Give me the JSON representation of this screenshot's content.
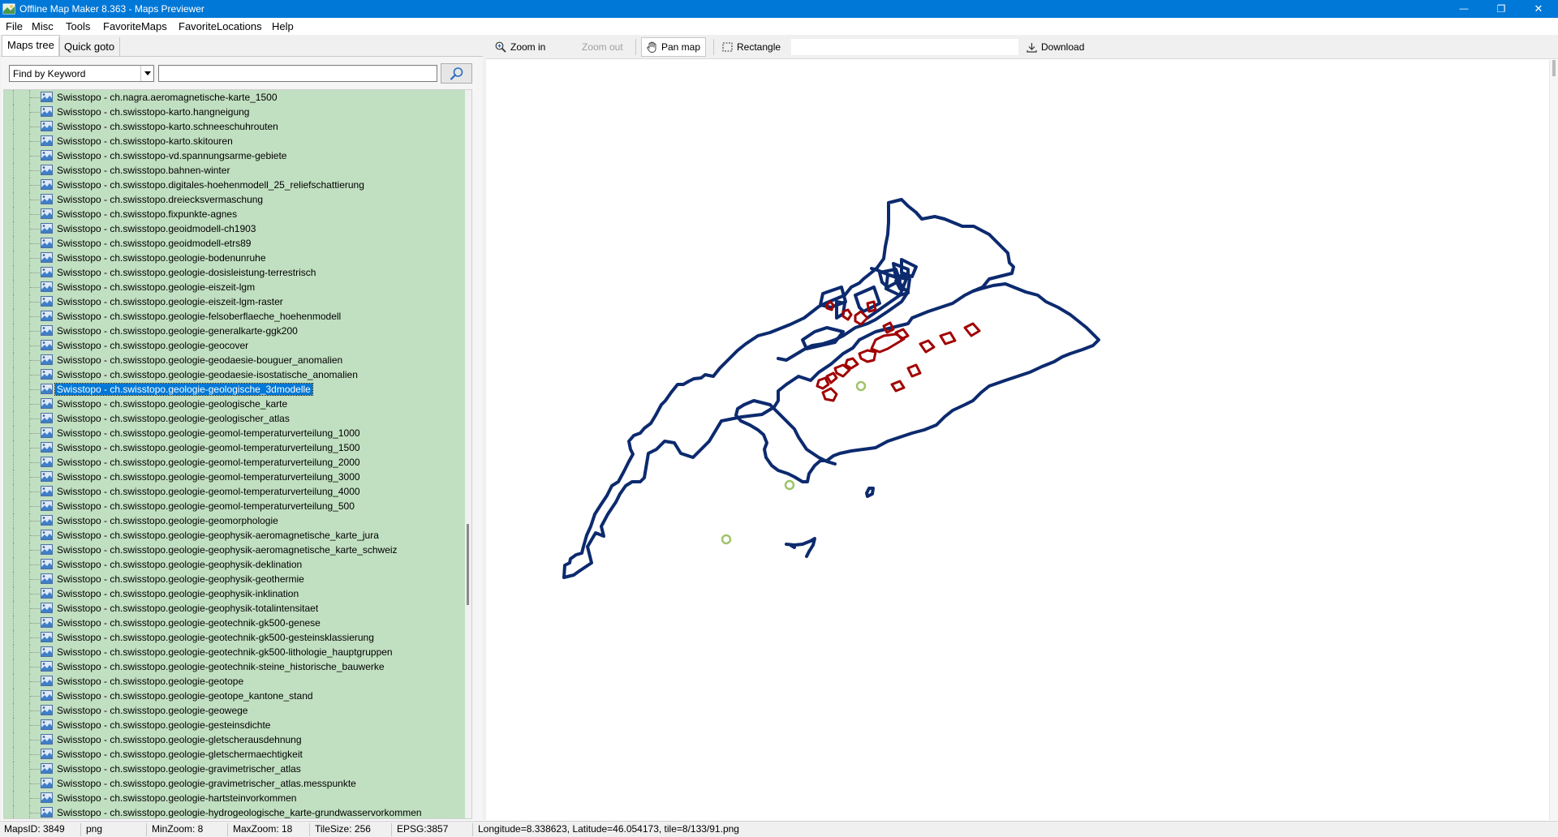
{
  "window": {
    "title": "Offline Map Maker 8.363 - Maps Previewer",
    "minimize_glyph": "—",
    "maximize_glyph": "❐",
    "close_glyph": "✕"
  },
  "menu": {
    "items": [
      "File",
      "Misc",
      "Tools",
      "FavoriteMaps",
      "FavoriteLocations",
      "Help"
    ]
  },
  "tabs": {
    "maps_tree": "Maps tree",
    "quick_goto": "Quick goto"
  },
  "search": {
    "mode": "Find by Keyword",
    "value": ""
  },
  "tree": {
    "selected_index": 20,
    "items": [
      "Swisstopo - ch.nagra.aeromagnetische-karte_1500",
      "Swisstopo - ch.swisstopo-karto.hangneigung",
      "Swisstopo - ch.swisstopo-karto.schneeschuhrouten",
      "Swisstopo - ch.swisstopo-karto.skitouren",
      "Swisstopo - ch.swisstopo-vd.spannungsarme-gebiete",
      "Swisstopo - ch.swisstopo.bahnen-winter",
      "Swisstopo - ch.swisstopo.digitales-hoehenmodell_25_reliefschattierung",
      "Swisstopo - ch.swisstopo.dreiecksvermaschung",
      "Swisstopo - ch.swisstopo.fixpunkte-agnes",
      "Swisstopo - ch.swisstopo.geoidmodell-ch1903",
      "Swisstopo - ch.swisstopo.geoidmodell-etrs89",
      "Swisstopo - ch.swisstopo.geologie-bodenunruhe",
      "Swisstopo - ch.swisstopo.geologie-dosisleistung-terrestrisch",
      "Swisstopo - ch.swisstopo.geologie-eiszeit-lgm",
      "Swisstopo - ch.swisstopo.geologie-eiszeit-lgm-raster",
      "Swisstopo - ch.swisstopo.geologie-felsoberflaeche_hoehenmodell",
      "Swisstopo - ch.swisstopo.geologie-generalkarte-ggk200",
      "Swisstopo - ch.swisstopo.geologie-geocover",
      "Swisstopo - ch.swisstopo.geologie-geodaesie-bouguer_anomalien",
      "Swisstopo - ch.swisstopo.geologie-geodaesie-isostatische_anomalien",
      "Swisstopo - ch.swisstopo.geologie-geologische_3dmodelle",
      "Swisstopo - ch.swisstopo.geologie-geologische_karte",
      "Swisstopo - ch.swisstopo.geologie-geologischer_atlas",
      "Swisstopo - ch.swisstopo.geologie-geomol-temperaturverteilung_1000",
      "Swisstopo - ch.swisstopo.geologie-geomol-temperaturverteilung_1500",
      "Swisstopo - ch.swisstopo.geologie-geomol-temperaturverteilung_2000",
      "Swisstopo - ch.swisstopo.geologie-geomol-temperaturverteilung_3000",
      "Swisstopo - ch.swisstopo.geologie-geomol-temperaturverteilung_4000",
      "Swisstopo - ch.swisstopo.geologie-geomol-temperaturverteilung_500",
      "Swisstopo - ch.swisstopo.geologie-geomorphologie",
      "Swisstopo - ch.swisstopo.geologie-geophysik-aeromagnetische_karte_jura",
      "Swisstopo - ch.swisstopo.geologie-geophysik-aeromagnetische_karte_schweiz",
      "Swisstopo - ch.swisstopo.geologie-geophysik-deklination",
      "Swisstopo - ch.swisstopo.geologie-geophysik-geothermie",
      "Swisstopo - ch.swisstopo.geologie-geophysik-inklination",
      "Swisstopo - ch.swisstopo.geologie-geophysik-totalintensitaet",
      "Swisstopo - ch.swisstopo.geologie-geotechnik-gk500-genese",
      "Swisstopo - ch.swisstopo.geologie-geotechnik-gk500-gesteinsklassierung",
      "Swisstopo - ch.swisstopo.geologie-geotechnik-gk500-lithologie_hauptgruppen",
      "Swisstopo - ch.swisstopo.geologie-geotechnik-steine_historische_bauwerke",
      "Swisstopo - ch.swisstopo.geologie-geotope",
      "Swisstopo - ch.swisstopo.geologie-geotope_kantone_stand",
      "Swisstopo - ch.swisstopo.geologie-geowege",
      "Swisstopo - ch.swisstopo.geologie-gesteinsdichte",
      "Swisstopo - ch.swisstopo.geologie-gletscherausdehnung",
      "Swisstopo - ch.swisstopo.geologie-gletschermaechtigkeit",
      "Swisstopo - ch.swisstopo.geologie-gravimetrischer_atlas",
      "Swisstopo - ch.swisstopo.geologie-gravimetrischer_atlas.messpunkte",
      "Swisstopo - ch.swisstopo.geologie-hartsteinvorkommen",
      "Swisstopo - ch.swisstopo.geologie-hydrogeologische_karte-grundwasservorkommen"
    ]
  },
  "toolbar": {
    "zoom_in": "Zoom in",
    "zoom_out": "Zoom out",
    "pan_map": "Pan map",
    "rectangle": "Rectangle",
    "download": "Download"
  },
  "map": {
    "outline_color": "#0c2a6e",
    "region_color": "#a00000",
    "marker_color": "#9ec46a"
  },
  "status": {
    "maps_id": "MapsID: 3849",
    "format": "png",
    "min_zoom": "MinZoom: 8",
    "max_zoom": "MaxZoom: 18",
    "tile_size": "TileSize: 256",
    "epsg": "EPSG:3857",
    "cursor": "Longitude=8.338623, Latitude=46.054173, tile=8/133/91.png"
  }
}
